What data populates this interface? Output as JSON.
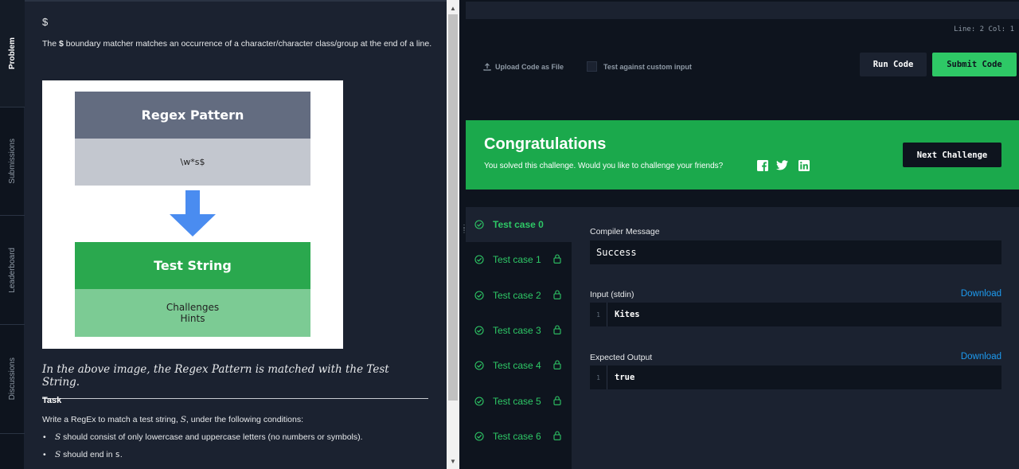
{
  "side_tabs": [
    "Problem",
    "Submissions",
    "Leaderboard",
    "Discussions"
  ],
  "problem": {
    "dollar_heading": "$",
    "desc_pre": "The ",
    "desc_bold": "$",
    "desc_post": " boundary matcher matches an occurrence of a character/character class/group at the end of a line.",
    "diagram": {
      "pattern_title": "Regex Pattern",
      "pattern_value": "\\w*s$",
      "string_title": "Test String",
      "string_line1": "Challenges",
      "string_line2": "Hints"
    },
    "caption": "In the above image, the Regex Pattern is matched with the Test String.",
    "task_heading": "Task",
    "task_text_pre": "Write a RegEx to match a test string, ",
    "task_text_var": "S",
    "task_text_post": ", under the following conditions:",
    "conditions": [
      {
        "var": "S",
        "text": " should consist of only lowercase and uppercase letters (no numbers or symbols)."
      },
      {
        "var": "S",
        "text": " should end in ",
        "code": "s",
        "end": "."
      }
    ]
  },
  "editor": {
    "status": "Line: 2 Col: 1",
    "upload_label": "Upload Code as File",
    "custom_input_label": "Test against custom input",
    "run_label": "Run Code",
    "submit_label": "Submit Code"
  },
  "congrats": {
    "title": "Congratulations",
    "text": "You solved this challenge. Would you like to challenge your friends?",
    "next_label": "Next Challenge"
  },
  "test_cases": [
    {
      "label": "Test case 0",
      "locked": false,
      "active": true
    },
    {
      "label": "Test case 1",
      "locked": true,
      "active": false
    },
    {
      "label": "Test case 2",
      "locked": true,
      "active": false
    },
    {
      "label": "Test case 3",
      "locked": true,
      "active": false
    },
    {
      "label": "Test case 4",
      "locked": true,
      "active": false
    },
    {
      "label": "Test case 5",
      "locked": true,
      "active": false
    },
    {
      "label": "Test case 6",
      "locked": true,
      "active": false
    }
  ],
  "result": {
    "compiler_label": "Compiler Message",
    "compiler_value": "Success",
    "input_label": "Input (stdin)",
    "input_line_no": "1",
    "input_value": "Kites",
    "expected_label": "Expected Output",
    "expected_line_no": "1",
    "expected_value": "true",
    "download_label": "Download"
  },
  "colors": {
    "accent_green": "#2ec866",
    "banner_green": "#1ba94c",
    "link_blue": "#1d9bf0",
    "bg_dark": "#0e141e",
    "panel": "#1b2230"
  }
}
